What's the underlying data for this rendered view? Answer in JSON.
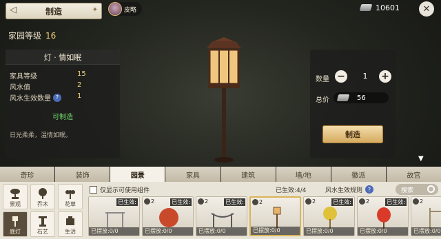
{
  "header": {
    "title": "制造",
    "user_name": "皮略",
    "currency_amount": "10601"
  },
  "home": {
    "label": "家园等级",
    "level": "16"
  },
  "item": {
    "name": "灯 · 情如眠",
    "stats": [
      {
        "label": "家具等级",
        "value": "15"
      },
      {
        "label": "风水值",
        "value": "2"
      },
      {
        "label": "风水生效数量",
        "value": "1",
        "help": true
      }
    ],
    "craftable": "可制造",
    "description": "日光柔柔，温情如眠。"
  },
  "purchase": {
    "qty_label": "数量",
    "qty": "1",
    "price_label": "总价",
    "price": "56",
    "make_label": "制造"
  },
  "tabs": [
    {
      "label": "奇珍",
      "active": false
    },
    {
      "label": "装饰",
      "active": false
    },
    {
      "label": "园景",
      "active": true
    },
    {
      "label": "家具",
      "active": false
    },
    {
      "label": "建筑",
      "active": false
    },
    {
      "label": "墙/地",
      "active": false
    },
    {
      "label": "徽派",
      "active": false
    },
    {
      "label": "故宫",
      "active": false
    }
  ],
  "categories": [
    {
      "label": "景观",
      "icon": "bonsai-icon",
      "active": false
    },
    {
      "label": "乔木",
      "icon": "tree-icon",
      "active": false
    },
    {
      "label": "花草",
      "icon": "flower-icon",
      "active": false
    },
    {
      "label": "庭灯",
      "icon": "lamp-icon",
      "active": true
    },
    {
      "label": "石艺",
      "icon": "stone-icon",
      "active": false
    },
    {
      "label": "生活",
      "icon": "life-icon",
      "active": false
    }
  ],
  "filter": {
    "label": "仅显示可使用组件",
    "active_count": "已生效:4/4",
    "rule_label": "风水生效规则",
    "search_placeholder": "搜索"
  },
  "items": [
    {
      "cost": "",
      "badge": "已生效:",
      "placed": "已摆放:0/0",
      "color": "#8a8a8a",
      "selected": false
    },
    {
      "cost": "2",
      "badge": "已生效:",
      "placed": "已摆放:0/0",
      "color": "#c94a2a",
      "selected": false
    },
    {
      "cost": "2",
      "badge": "已生效:",
      "placed": "已摆放:0/0",
      "color": "#5a5a5a",
      "selected": false
    },
    {
      "cost": "2",
      "badge": "",
      "placed": "已摆放:0/0",
      "color": "#6a4a2a",
      "selected": true
    },
    {
      "cost": "2",
      "badge": "已生效:",
      "placed": "已摆放:0/0",
      "color": "#e0c23a",
      "selected": false
    },
    {
      "cost": "2",
      "badge": "已生效:",
      "placed": "已摆放:0/0",
      "color": "#d93a2a",
      "selected": false
    },
    {
      "cost": "2",
      "badge": "",
      "placed": "已摆放:0/0",
      "color": "#9a8a6a",
      "selected": false
    }
  ],
  "colors": {
    "accent_gold": "#f3d27a",
    "craftable_green": "#6fd36c"
  }
}
